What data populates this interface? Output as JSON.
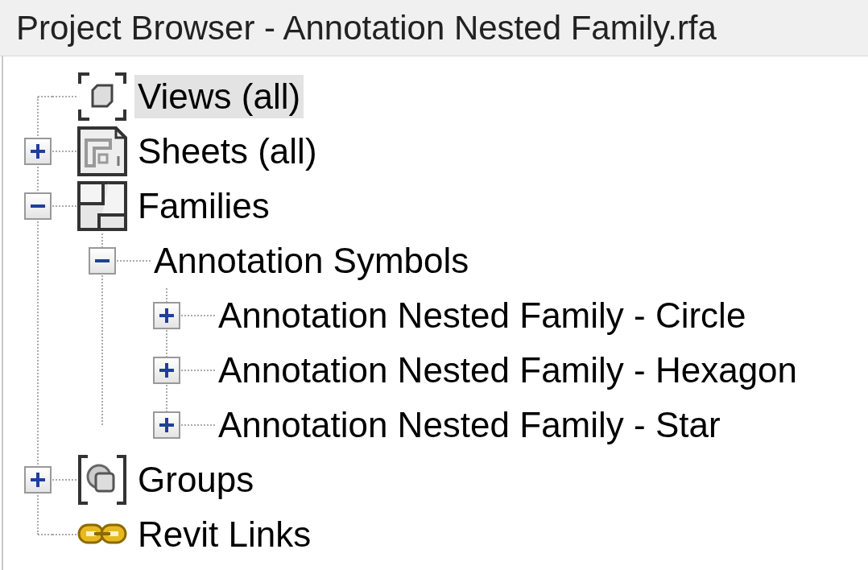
{
  "window": {
    "title": "Project Browser - Annotation Nested Family.rfa"
  },
  "tree": [
    {
      "label": "Views (all)",
      "kind": "views",
      "selected": true
    },
    {
      "label": "Sheets (all)",
      "kind": "sheets",
      "selected": false,
      "expanded": false
    },
    {
      "label": "Families",
      "kind": "families",
      "selected": false,
      "expanded": true,
      "children": [
        {
          "label": "Annotation Symbols",
          "selected": false,
          "expanded": true,
          "children": [
            {
              "label": "Annotation Nested Family - Circle",
              "selected": false,
              "expanded": false
            },
            {
              "label": "Annotation Nested Family - Hexagon",
              "selected": false,
              "expanded": false
            },
            {
              "label": "Annotation Nested Family - Star",
              "selected": false,
              "expanded": false
            }
          ]
        }
      ]
    },
    {
      "label": "Groups",
      "kind": "groups",
      "selected": false,
      "expanded": false
    },
    {
      "label": "Revit Links",
      "kind": "links",
      "selected": false
    }
  ]
}
